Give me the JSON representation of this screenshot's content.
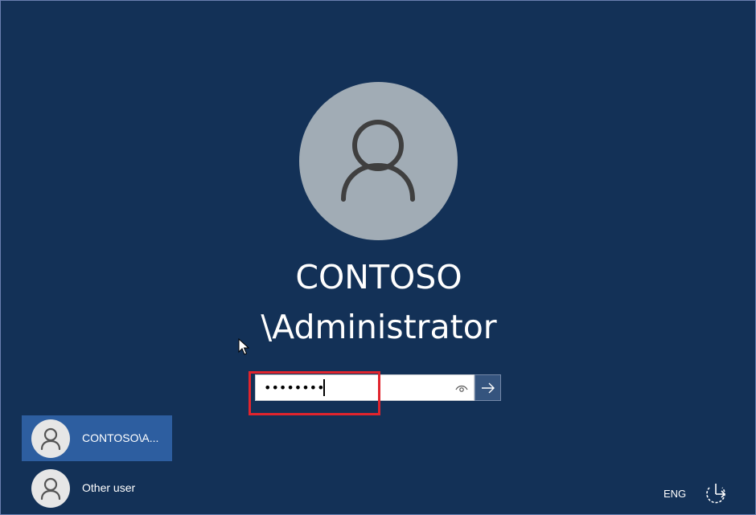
{
  "login": {
    "username_line1": "CONTOSO",
    "username_line2": "\\Administrator",
    "password_value": "••••••••"
  },
  "user_list": [
    {
      "label": "CONTOSO\\A...",
      "selected": true
    },
    {
      "label": "Other user",
      "selected": false
    }
  ],
  "system": {
    "language": "ENG"
  },
  "icons": {
    "avatar": "user-avatar-icon",
    "reveal": "eye-icon",
    "submit": "arrow-right-icon",
    "power": "power-options-icon",
    "pointer": "mouse-pointer-icon"
  },
  "colors": {
    "background": "#133157",
    "avatar_bg": "#a1acb5",
    "selected_user": "#2d5ea0",
    "annotation_box": "#e1242d",
    "submit_button": "#35547e"
  }
}
